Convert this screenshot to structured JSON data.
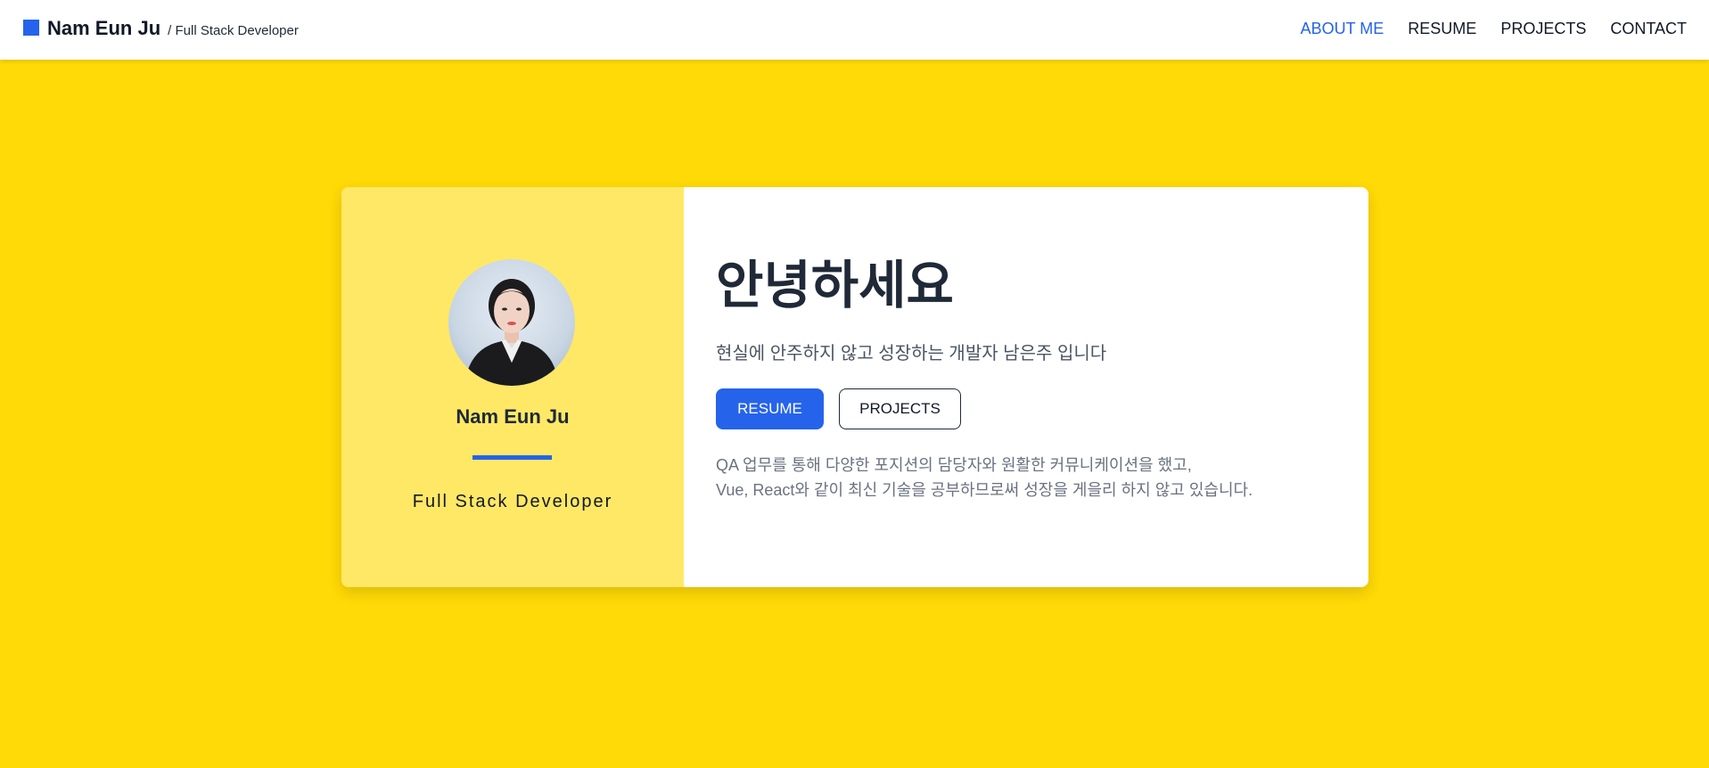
{
  "header": {
    "brand_name": "Nam Eun Ju",
    "brand_sub": "/ Full Stack Developer",
    "nav": [
      {
        "label": "ABOUT ME",
        "active": true
      },
      {
        "label": "RESUME",
        "active": false
      },
      {
        "label": "PROJECTS",
        "active": false
      },
      {
        "label": "CONTACT",
        "active": false
      }
    ]
  },
  "profile": {
    "name": "Nam Eun Ju",
    "role": "Full Stack Developer"
  },
  "intro": {
    "greeting": "안녕하세요",
    "tagline": "현실에 안주하지 않고 성장하는 개발자 남은주 입니다",
    "resume_button": "RESUME",
    "projects_button": "PROJECTS",
    "description_line1": "QA 업무를 통해 다양한 포지션의 담당자와 원활한 커뮤니케이션을 했고,",
    "description_line2": "Vue, React와 같이 최신 기술을 공부하므로써 성장을 게을리 하지 않고 있습니다."
  },
  "colors": {
    "background": "#FFDA06",
    "card_left": "#FFE866",
    "accent": "#2563EB"
  }
}
